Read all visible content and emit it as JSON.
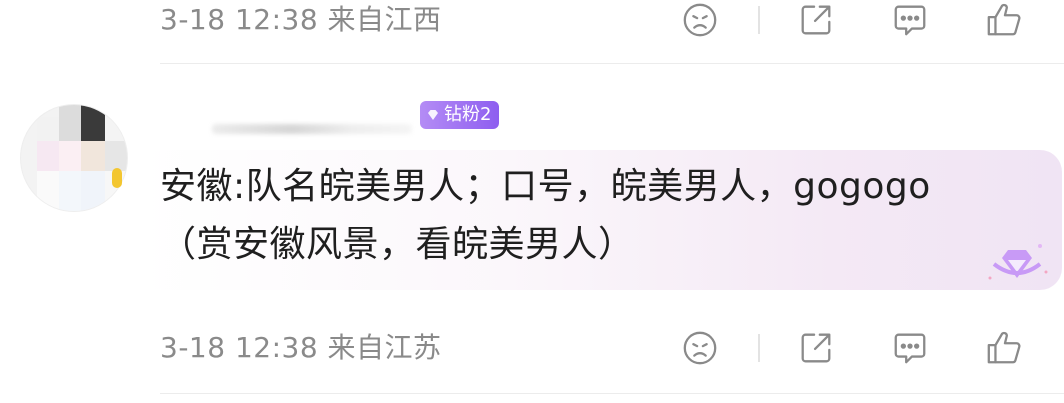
{
  "comments": [
    {
      "timestamp": "3-18 12:38",
      "location": "来自江西"
    },
    {
      "badge": "钻粉2",
      "text_line1": "安徽:队名皖美男人；口号，皖美男人，gogogo",
      "text_line2": "（赏安徽风景，看皖美男人）",
      "timestamp": "3-18 12:38",
      "location": "来自江苏"
    }
  ],
  "actions": [
    "dislike-icon",
    "share-icon",
    "comment-icon",
    "like-icon"
  ],
  "colors": {
    "meta_text": "#8a8a8a",
    "badge_start": "#b48cf5",
    "badge_end": "#8e5ef0",
    "bubble_tint": "#f0e4f4",
    "icon": "#8a8a8a"
  }
}
